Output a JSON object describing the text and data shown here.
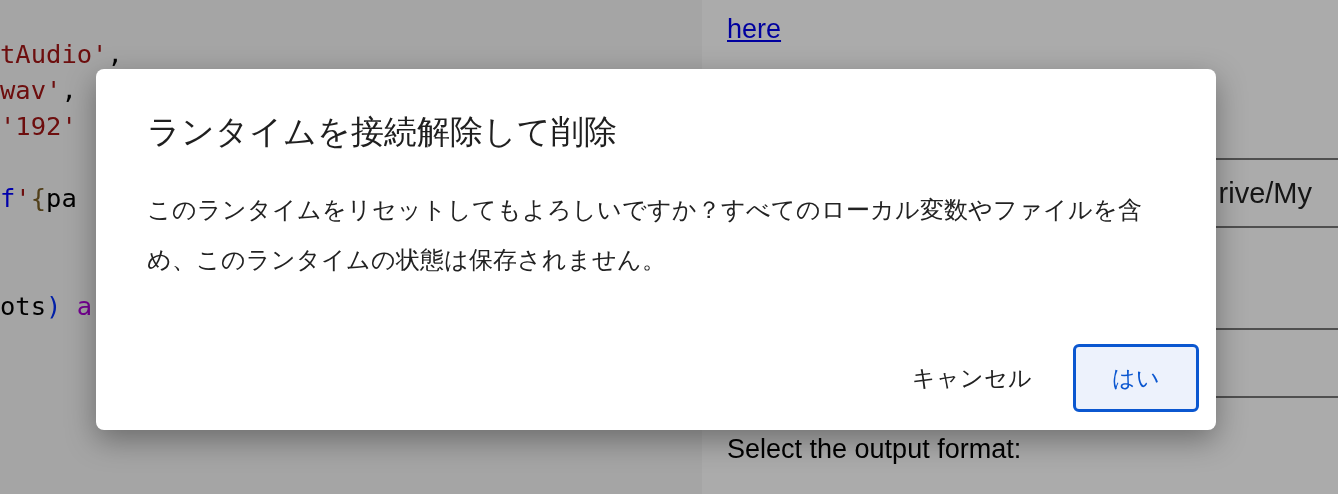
{
  "code_lines": [
    {
      "tokens": [
        {
          "kind": "string",
          "text": "tAudio'"
        },
        {
          "kind": "punct",
          "text": ","
        }
      ]
    },
    {
      "tokens": [
        {
          "kind": "string",
          "text": "wav'"
        },
        {
          "kind": "punct",
          "text": ","
        }
      ]
    },
    {
      "tokens": [
        {
          "kind": "string",
          "text": "'192'"
        }
      ]
    },
    {
      "tokens": [
        {
          "kind": "builtin",
          "text": "f"
        },
        {
          "kind": "string",
          "text": "'"
        },
        {
          "kind": "brace",
          "text": "{"
        },
        {
          "kind": "name",
          "text": "pa"
        }
      ]
    },
    {
      "tokens": [
        {
          "kind": "name",
          "text": "ots"
        },
        {
          "kind": "paren",
          "text": ")"
        },
        {
          "kind": "keyword",
          "text": " a"
        }
      ]
    }
  ],
  "form": {
    "link": "here",
    "path_field": {
      "value": "rive/My"
    },
    "format_label": "Select the output format:"
  },
  "dialog": {
    "title": "ランタイムを接続解除して削除",
    "message": "このランタイムをリセットしてもよろしいですか？すべてのローカル変数やファイルを含め、このランタイムの状態は保存されません。",
    "buttons": [
      {
        "label": "キャンセル",
        "kind": "text"
      },
      {
        "label": "はい",
        "kind": "primary"
      }
    ]
  }
}
